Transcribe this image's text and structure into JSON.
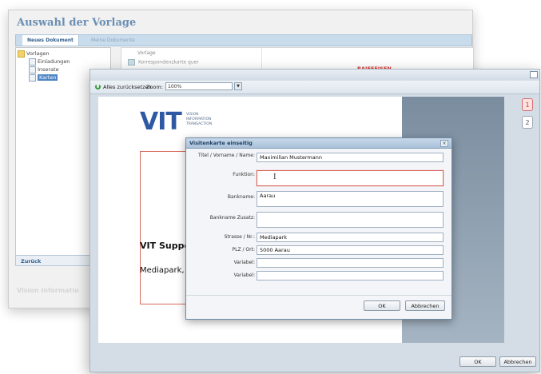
{
  "background_window": {
    "title": "Auswahl der Vorlage",
    "tabs": [
      {
        "label": "Neues Dokument"
      },
      {
        "label": "Meine Dokumente"
      }
    ],
    "tree": {
      "root": "Vorlagen",
      "items": [
        {
          "label": "Einladungen"
        },
        {
          "label": "Inserate"
        },
        {
          "label": "Karten"
        }
      ]
    },
    "list": {
      "column_header": "Vorlage",
      "item": "Korrespondenzkarte quer",
      "brand": "RAIFFEISEN"
    },
    "back_button": "Zurück",
    "footer": "Vision Informatio"
  },
  "preview_window": {
    "toolbar": {
      "reset_label": "Alles zurücksetzen",
      "zoom_label": "Zoom:",
      "zoom_value": "100%"
    },
    "card": {
      "logo": "VIT",
      "tagline": [
        "VISION",
        "INFORMATION",
        "TRANSACTION"
      ],
      "support_text": "VIT Support",
      "address_text": "Mediapark, 50"
    },
    "pages": [
      "1",
      "2"
    ],
    "buttons": {
      "ok": "OK",
      "cancel": "Abbrechen"
    }
  },
  "dialog": {
    "title": "Visitenkarte einseitig",
    "close": "×",
    "fields": [
      {
        "label": "Titel / Vorname / Name:",
        "value": "Maximilian Mustermann"
      },
      {
        "label": "Funktion:",
        "value": ""
      },
      {
        "label": "Bankname:",
        "value": "Aarau"
      },
      {
        "label": "Bankname Zusatz:",
        "value": ""
      },
      {
        "label": "Strasse / Nr.:",
        "value": "Mediapark"
      },
      {
        "label": "PLZ / Ort:",
        "value": "5000 Aarau"
      },
      {
        "label": "Variabel:",
        "value": ""
      },
      {
        "label": "Variabel:",
        "value": ""
      }
    ],
    "buttons": {
      "ok": "OK",
      "cancel": "Abbrechen"
    }
  }
}
